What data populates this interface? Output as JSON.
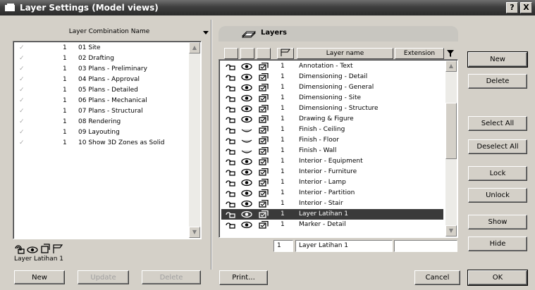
{
  "window": {
    "title": "Layer Settings (Model views)",
    "help_label": "?",
    "close_label": "X"
  },
  "combinations": {
    "column_header": "Layer Combination Name",
    "rows": [
      {
        "check": "✓",
        "num": "1",
        "name": "01 Site"
      },
      {
        "check": "✓",
        "num": "1",
        "name": "02 Drafting"
      },
      {
        "check": "✓",
        "num": "1",
        "name": "03 Plans - Preliminary"
      },
      {
        "check": "✓",
        "num": "1",
        "name": "04 Plans - Approval"
      },
      {
        "check": "✓",
        "num": "1",
        "name": "05 Plans - Detailed"
      },
      {
        "check": "✓",
        "num": "1",
        "name": "06 Plans - Mechanical"
      },
      {
        "check": "✓",
        "num": "1",
        "name": "07 Plans - Structural"
      },
      {
        "check": "✓",
        "num": "1",
        "name": "08 Rendering"
      },
      {
        "check": "✓",
        "num": "1",
        "name": "09 Layouting"
      },
      {
        "check": "✓",
        "num": "1",
        "name": "10 Show 3D Zones as Solid"
      }
    ],
    "current_name": "Layer Latihan 1",
    "new_label": "New",
    "update_label": "Update",
    "delete_label": "Delete"
  },
  "layers": {
    "tab_title": "Layers",
    "col_name": "Layer name",
    "col_extension": "Extension",
    "rows": [
      {
        "num": "1",
        "name": "Annotation - Text",
        "visible": true
      },
      {
        "num": "1",
        "name": "Dimensioning - Detail",
        "visible": true
      },
      {
        "num": "1",
        "name": "Dimensioning - General",
        "visible": true
      },
      {
        "num": "1",
        "name": "Dimensioning - Site",
        "visible": true
      },
      {
        "num": "1",
        "name": "Dimensioning - Structure",
        "visible": true
      },
      {
        "num": "1",
        "name": "Drawing & Figure",
        "visible": true
      },
      {
        "num": "1",
        "name": "Finish - Ceiling",
        "visible": false
      },
      {
        "num": "1",
        "name": "Finish - Floor",
        "visible": false
      },
      {
        "num": "1",
        "name": "Finish - Wall",
        "visible": false
      },
      {
        "num": "1",
        "name": "Interior - Equipment",
        "visible": true
      },
      {
        "num": "1",
        "name": "Interior - Furniture",
        "visible": true
      },
      {
        "num": "1",
        "name": "Interior - Lamp",
        "visible": true
      },
      {
        "num": "1",
        "name": "Interior - Partition",
        "visible": true
      },
      {
        "num": "1",
        "name": "Interior - Stair",
        "visible": true
      },
      {
        "num": "1",
        "name": "Layer Latihan 1",
        "visible": true,
        "selected": true
      },
      {
        "num": "1",
        "name": "Marker - Detail",
        "visible": true
      }
    ],
    "edit_num": "1",
    "edit_name": "Layer Latihan 1",
    "edit_ext": ""
  },
  "buttons": {
    "new": "New",
    "delete": "Delete",
    "select_all": "Select All",
    "deselect_all": "Deselect All",
    "lock": "Lock",
    "unlock": "Unlock",
    "show": "Show",
    "hide": "Hide",
    "print": "Print...",
    "cancel": "Cancel",
    "ok": "OK"
  },
  "colors": {
    "selection": "#3a3a3a",
    "dialog_bg": "#d4d0c8"
  }
}
